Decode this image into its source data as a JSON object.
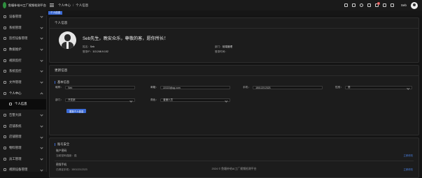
{
  "app": {
    "title": "鱼塘补给AI工厂视频检测平台"
  },
  "sidebar": {
    "items": [
      {
        "label": "设备管理"
      },
      {
        "label": "系统管理"
      },
      {
        "label": "监控设备管理"
      },
      {
        "label": "数据维护"
      },
      {
        "label": "视频监控"
      },
      {
        "label": "系统监控"
      },
      {
        "label": "文件管理"
      },
      {
        "label": "个人中心"
      },
      {
        "label": "个人信息"
      },
      {
        "label": "告警大屏"
      },
      {
        "label": "店铺系统"
      },
      {
        "label": "店铺管理"
      },
      {
        "label": "物料管理"
      },
      {
        "label": "员工管理"
      },
      {
        "label": "视频设备管理"
      }
    ]
  },
  "breadcrumb": {
    "home": "个人中心",
    "current": "个人信息"
  },
  "topbar": {
    "username": "Seb",
    "badge": "1"
  },
  "tabs": [
    {
      "label": "个人信息"
    }
  ],
  "profile": {
    "title": "个人信息",
    "greeting": "Seb先生，晚安众乐，尊敬的客，愿你所长！",
    "name_label": "姓名：",
    "name_value": "Seb",
    "ip_label": "登录IP：",
    "ip_value": "113.246.9.102",
    "dept_label": "部门：",
    "dept_value": "前端管理",
    "time_label": "登录时间："
  },
  "update": {
    "title": "更新信息",
    "section": "基本信息",
    "nickname_label": "昵称：",
    "nickname_value": "Seb",
    "email_label": "邮箱：",
    "email_value": "22222@qq.com",
    "phone_label": "手机：",
    "phone_value": "15012212323",
    "gender_label": "性别：",
    "gender_value": "男",
    "dept_label": "部门：",
    "dept_value": "开发部",
    "role_label": "角色：",
    "role_value": "普通人员",
    "save_label": "更新个人信息"
  },
  "security": {
    "section": "账号安全",
    "password_title": "账户密码",
    "password_sub": "当前密码强度：强",
    "phone_title": "密保手机",
    "phone_sub": "已绑定手机：15012212323",
    "modify_label": "立即修改"
  },
  "footer": {
    "text": "2024 © 鱼塘补给AI工厂视频检测平台"
  },
  "colors": {
    "accent": "#3c6bd6",
    "background": "#141414",
    "panel": "#1c1c1c"
  }
}
